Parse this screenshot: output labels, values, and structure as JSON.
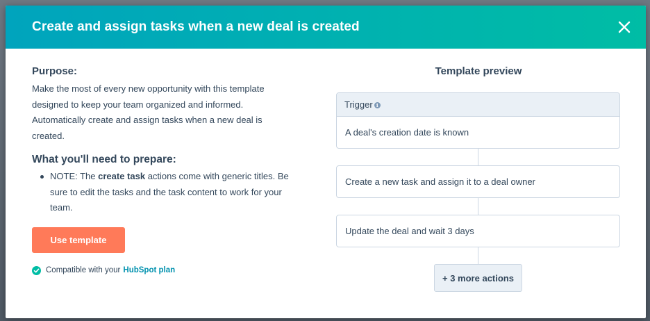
{
  "modal": {
    "title": "Create and assign tasks when a new deal is created",
    "close_icon": "close-icon"
  },
  "left": {
    "purpose_heading": "Purpose:",
    "purpose_lines": [
      "Make the most of every new opportunity with this template",
      "designed to keep your team organized and informed.",
      "Automatically create and assign tasks when a new deal is",
      "created."
    ],
    "prepare_heading": "What you'll need to prepare:",
    "note_prefix": "NOTE: The ",
    "note_bold": "create task",
    "note_line1_rest": " actions come with generic titles. Be",
    "note_line2": "sure to edit the tasks and the task content to work for your",
    "note_line3": "team.",
    "use_template_label": "Use template",
    "compat_text": "Compatible with your",
    "compat_link": "HubSpot plan"
  },
  "preview": {
    "title": "Template preview",
    "trigger_label": "Trigger",
    "trigger_text": "A deal's creation date is known",
    "actions": [
      "Create a new task and assign it to a deal owner",
      "Update the deal and wait 3 days"
    ],
    "more_actions_label": "+ 3 more actions"
  },
  "colors": {
    "header_start": "#00a4bd",
    "header_end": "#00bda5",
    "primary_button": "#ff7a59",
    "link": "#0091ae",
    "check": "#00bda5"
  }
}
